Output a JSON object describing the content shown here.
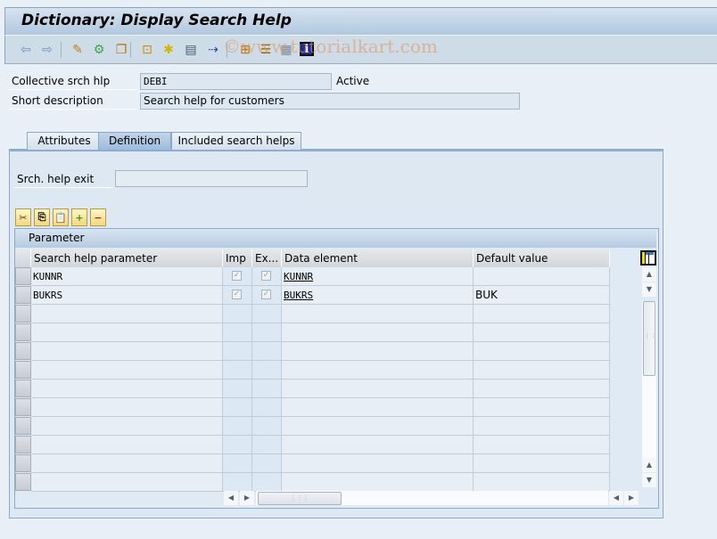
{
  "window": {
    "title": "Dictionary: Display Search Help"
  },
  "toolbar": {
    "icons": [
      {
        "name": "back-icon",
        "glyph": "⇦",
        "color": "#6d8fc9"
      },
      {
        "name": "forward-icon",
        "glyph": "⇨",
        "color": "#6d8fc9"
      },
      {
        "name": "display-change-icon",
        "glyph": "✎",
        "color": "#c27b15"
      },
      {
        "name": "other-object-icon",
        "glyph": "⚙",
        "color": "#3ea34a"
      },
      {
        "name": "activate-check-icon",
        "glyph": "❐",
        "color": "#c76a00"
      },
      {
        "name": "where-used-list-icon",
        "glyph": "⊡",
        "color": "#d08a00"
      },
      {
        "name": "activate-icon",
        "glyph": "✱",
        "color": "#d1b800"
      },
      {
        "name": "test-icon",
        "glyph": "▤",
        "color": "#465a6e"
      },
      {
        "name": "navigate-icon",
        "glyph": "⇢",
        "color": "#2d4d99"
      },
      {
        "name": "hierarchy-icon",
        "glyph": "⊞",
        "color": "#b86f00"
      },
      {
        "name": "object-list-icon",
        "glyph": "☰",
        "color": "#8a6500"
      },
      {
        "name": "documentation-icon",
        "glyph": "▦",
        "color": "#7a8898"
      },
      {
        "name": "info-icon",
        "glyph": "i",
        "color": "#ffffff"
      }
    ],
    "watermark": "©www.tutorialkart.com"
  },
  "header": {
    "collective_label": "Collective srch hlp",
    "collective_value": "DEBI",
    "status": "Active",
    "short_desc_label": "Short description",
    "short_desc_value": "Search help for customers"
  },
  "tabs": [
    {
      "label": "Attributes",
      "active": false
    },
    {
      "label": "Definition",
      "active": true
    },
    {
      "label": "Included search helps",
      "active": false
    }
  ],
  "definition": {
    "exit_label": "Srch. help exit",
    "exit_value": ""
  },
  "table_toolbar": [
    {
      "name": "cut-icon",
      "glyph": "✂"
    },
    {
      "name": "copy-icon",
      "glyph": "⎘"
    },
    {
      "name": "paste-icon",
      "glyph": "📋"
    },
    {
      "name": "insert-row-icon",
      "glyph": "+"
    },
    {
      "name": "delete-row-icon",
      "glyph": "−"
    }
  ],
  "table": {
    "title": "Parameter",
    "columns": [
      "Search help parameter",
      "Imp",
      "Ex...",
      "Data element",
      "Default value"
    ],
    "rows": [
      {
        "param": "KUNNR",
        "imp": true,
        "exp": true,
        "data_element": "KUNNR",
        "default": ""
      },
      {
        "param": "BUKRS",
        "imp": true,
        "exp": true,
        "data_element": "BUKRS",
        "default": "BUK"
      },
      {
        "param": "",
        "imp": null,
        "exp": null,
        "data_element": "",
        "default": ""
      },
      {
        "param": "",
        "imp": null,
        "exp": null,
        "data_element": "",
        "default": ""
      },
      {
        "param": "",
        "imp": null,
        "exp": null,
        "data_element": "",
        "default": ""
      },
      {
        "param": "",
        "imp": null,
        "exp": null,
        "data_element": "",
        "default": ""
      },
      {
        "param": "",
        "imp": null,
        "exp": null,
        "data_element": "",
        "default": ""
      },
      {
        "param": "",
        "imp": null,
        "exp": null,
        "data_element": "",
        "default": ""
      },
      {
        "param": "",
        "imp": null,
        "exp": null,
        "data_element": "",
        "default": ""
      },
      {
        "param": "",
        "imp": null,
        "exp": null,
        "data_element": "",
        "default": ""
      },
      {
        "param": "",
        "imp": null,
        "exp": null,
        "data_element": "",
        "default": ""
      },
      {
        "param": "",
        "imp": null,
        "exp": null,
        "data_element": "",
        "default": ""
      }
    ]
  },
  "colors": {
    "accent": "#8eacd0",
    "title_bg": "#b1c8dd",
    "toolbar_bg": "#cedce8",
    "panel_bg": "#dde8f3"
  }
}
